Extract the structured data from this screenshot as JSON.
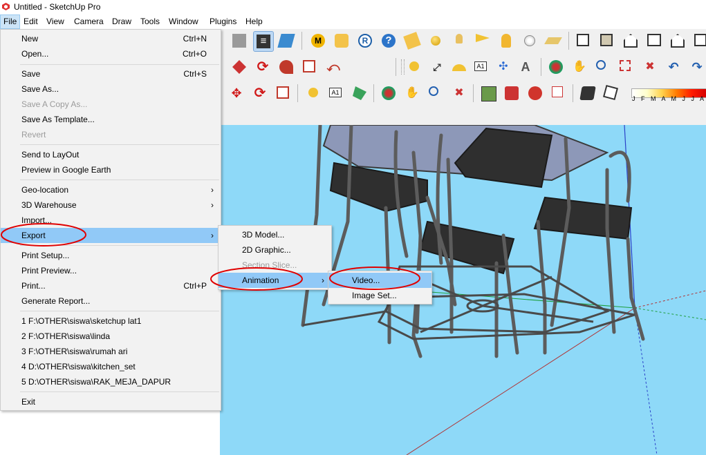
{
  "window": {
    "title": "Untitled - SketchUp Pro",
    "logo_icon": "sketchup-logo-icon"
  },
  "menubar": [
    "File",
    "Edit",
    "View",
    "Camera",
    "Draw",
    "Tools",
    "Window",
    "Plugins",
    "Help"
  ],
  "file_menu": {
    "new": {
      "label": "New",
      "shortcut": "Ctrl+N"
    },
    "open": {
      "label": "Open...",
      "shortcut": "Ctrl+O"
    },
    "save": {
      "label": "Save",
      "shortcut": "Ctrl+S"
    },
    "save_as": {
      "label": "Save As..."
    },
    "save_copy_as": {
      "label": "Save A Copy As..."
    },
    "save_as_template": {
      "label": "Save As Template..."
    },
    "revert": {
      "label": "Revert"
    },
    "send_to_layout": {
      "label": "Send to LayOut"
    },
    "preview_google_earth": {
      "label": "Preview in Google Earth"
    },
    "geo_location": {
      "label": "Geo-location"
    },
    "warehouse": {
      "label": "3D Warehouse"
    },
    "import": {
      "label": "Import..."
    },
    "export": {
      "label": "Export"
    },
    "print_setup": {
      "label": "Print Setup..."
    },
    "print_preview": {
      "label": "Print Preview..."
    },
    "print": {
      "label": "Print...",
      "shortcut": "Ctrl+P"
    },
    "generate_report": {
      "label": "Generate Report..."
    },
    "recent": [
      "1 F:\\OTHER\\siswa\\sketchup lat1",
      "2 F:\\OTHER\\siswa\\linda",
      "3 F:\\OTHER\\siswa\\rumah ari",
      "4 D:\\OTHER\\siswa\\kitchen_set",
      "5 D:\\OTHER\\siswa\\RAK_MEJA_DAPUR"
    ],
    "exit": {
      "label": "Exit"
    }
  },
  "export_submenu": {
    "model_3d": "3D Model...",
    "graphic_2d": "2D Graphic...",
    "section_slice": "Section Slice...",
    "animation": "Animation"
  },
  "animation_submenu": {
    "video": "Video...",
    "image_set": "Image Set..."
  },
  "shadow_months": "J F M A M J J A S",
  "colors": {
    "highlight": "#91c9f7",
    "viewport_sky": "#8ed9f8",
    "annotation_red": "#e00000"
  }
}
